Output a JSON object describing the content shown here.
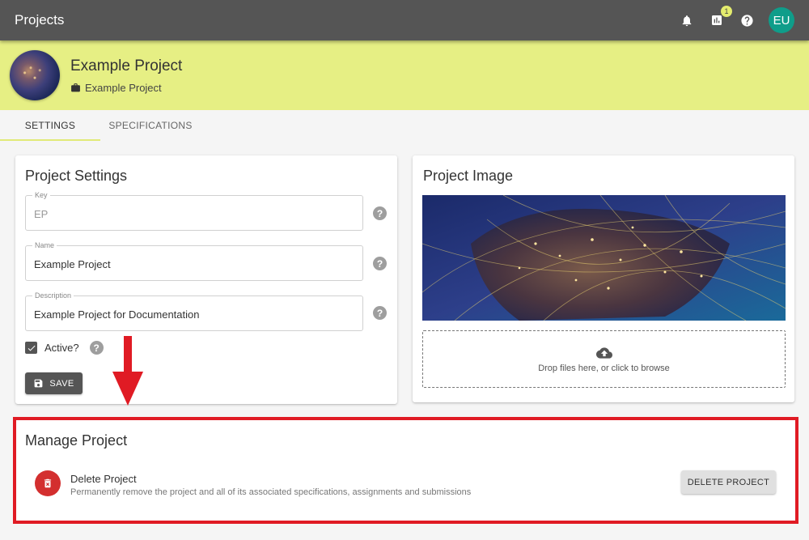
{
  "appbar": {
    "title": "Projects",
    "notifications_badge": "1",
    "avatar_initials": "EU"
  },
  "header": {
    "project_name": "Example Project",
    "project_subtitle": "Example Project"
  },
  "tabs": [
    {
      "label": "SETTINGS",
      "active": true
    },
    {
      "label": "SPECIFICATIONS",
      "active": false
    }
  ],
  "settings": {
    "title": "Project Settings",
    "key_label": "Key",
    "key_value": "EP",
    "name_label": "Name",
    "name_value": "Example Project",
    "description_label": "Description",
    "description_value": "Example Project for Documentation",
    "active_label": "Active?",
    "active_checked": true,
    "save_label": "SAVE",
    "help_glyph": "?"
  },
  "image": {
    "title": "Project Image",
    "dropzone_text": "Drop files here, or click to browse"
  },
  "manage": {
    "title": "Manage Project",
    "delete_title": "Delete Project",
    "delete_description": "Permanently remove the project and all of its associated specifications, assignments and submissions",
    "delete_button": "DELETE PROJECT"
  },
  "colors": {
    "appbar": "#555555",
    "header": "#e6ef84",
    "highlight": "#e01b24",
    "danger": "#d32f2f",
    "avatar": "#0f9d8a"
  },
  "icons": [
    "bell-icon",
    "chart-icon",
    "help-icon",
    "briefcase-icon",
    "checkbox-icon",
    "save-icon",
    "cloud-upload-icon",
    "trash-icon",
    "arrow-down-icon"
  ]
}
